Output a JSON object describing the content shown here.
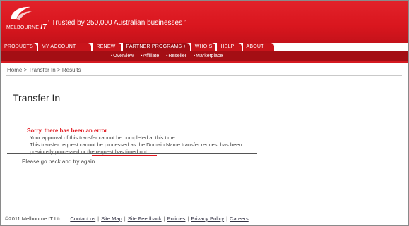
{
  "header": {
    "logo_small": "MELBOURNE",
    "logo_big": "IT",
    "tagline": "‘ Trusted by 250,000 Australian businesses ’"
  },
  "nav": {
    "tabs": [
      {
        "label": "PRODUCTS"
      },
      {
        "label": "MY ACCOUNT"
      },
      {
        "label": "RENEW"
      },
      {
        "label": "PARTNER PROGRAMS  +"
      },
      {
        "label": "WHOIS"
      },
      {
        "label": "HELP"
      },
      {
        "label": "ABOUT"
      }
    ],
    "subnav": [
      {
        "label": "Overview"
      },
      {
        "label": "Affiliate"
      },
      {
        "label": "Reseller"
      },
      {
        "label": "Marketplace"
      }
    ]
  },
  "breadcrumb": {
    "home": "Home",
    "sep": " > ",
    "transfer": "Transfer In",
    "results": "Results"
  },
  "page": {
    "title": "Transfer In",
    "error_heading": "Sorry, there has been an error",
    "error_lines": [
      "Your approval of this transfer cannot be completed at this time.",
      "This transfer request cannot be processed as the Domain Name transfer request has been",
      "previously processed or the request has timed out."
    ],
    "try_again": "Please go back and try again."
  },
  "footer": {
    "copyright": "©2011 Melbourne IT Ltd",
    "links": [
      {
        "label": "Contact us"
      },
      {
        "label": "Site Map"
      },
      {
        "label": "Site Feedback"
      },
      {
        "label": "Policies"
      },
      {
        "label": "Privacy Policy"
      },
      {
        "label": "Careers"
      }
    ],
    "separator": "|"
  },
  "colors": {
    "brand_red": "#d9161e",
    "dark_red": "#a40e14",
    "error_red": "#e31d24"
  },
  "icons": {
    "logo": "melbourne-it-swoosh-logo"
  }
}
